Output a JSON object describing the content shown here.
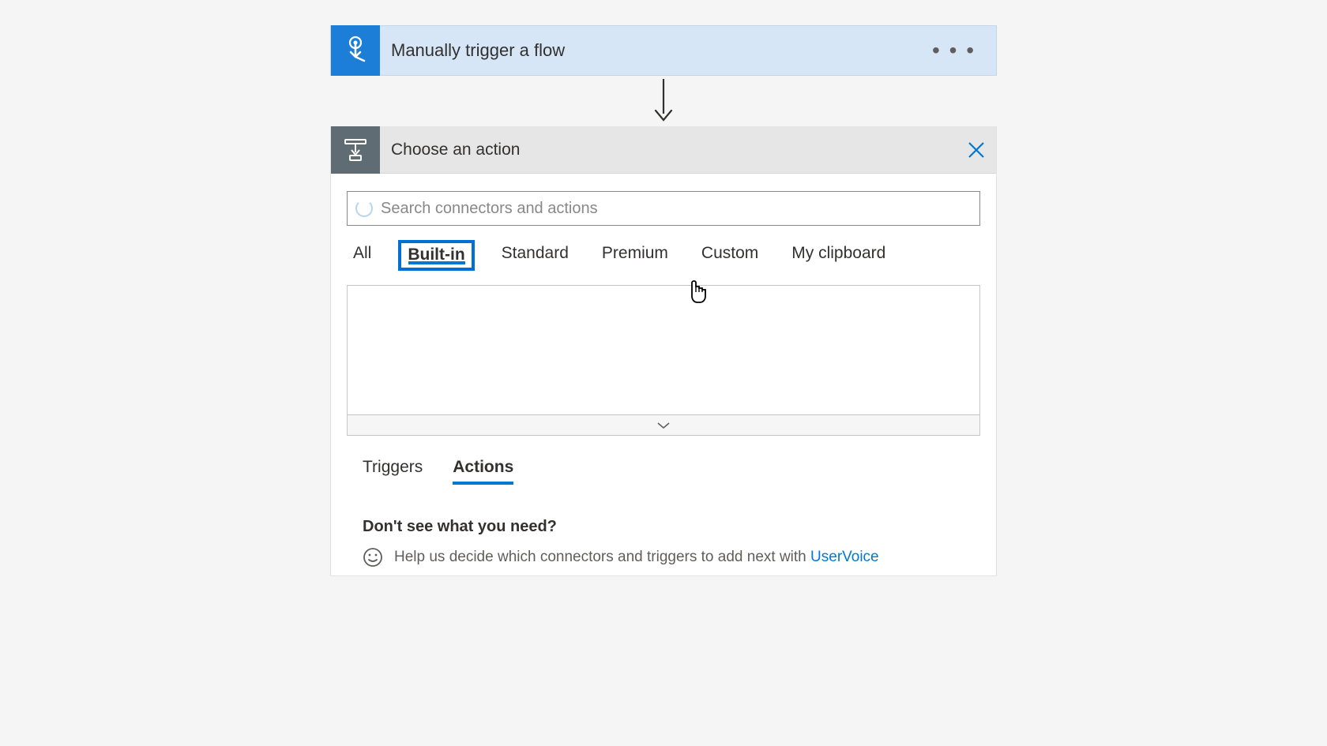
{
  "trigger": {
    "title": "Manually trigger a flow"
  },
  "action_picker": {
    "header_title": "Choose an action",
    "search_placeholder": "Search connectors and actions",
    "category_tabs": [
      {
        "label": "All",
        "active": false
      },
      {
        "label": "Built-in",
        "active": true
      },
      {
        "label": "Standard",
        "active": false
      },
      {
        "label": "Premium",
        "active": false
      },
      {
        "label": "Custom",
        "active": false
      },
      {
        "label": "My clipboard",
        "active": false
      }
    ],
    "ta_tabs": [
      {
        "label": "Triggers",
        "active": false
      },
      {
        "label": "Actions",
        "active": true
      }
    ],
    "help": {
      "title": "Don't see what you need?",
      "text": "Help us decide which connectors and triggers to add next with ",
      "link_text": "UserVoice"
    }
  }
}
